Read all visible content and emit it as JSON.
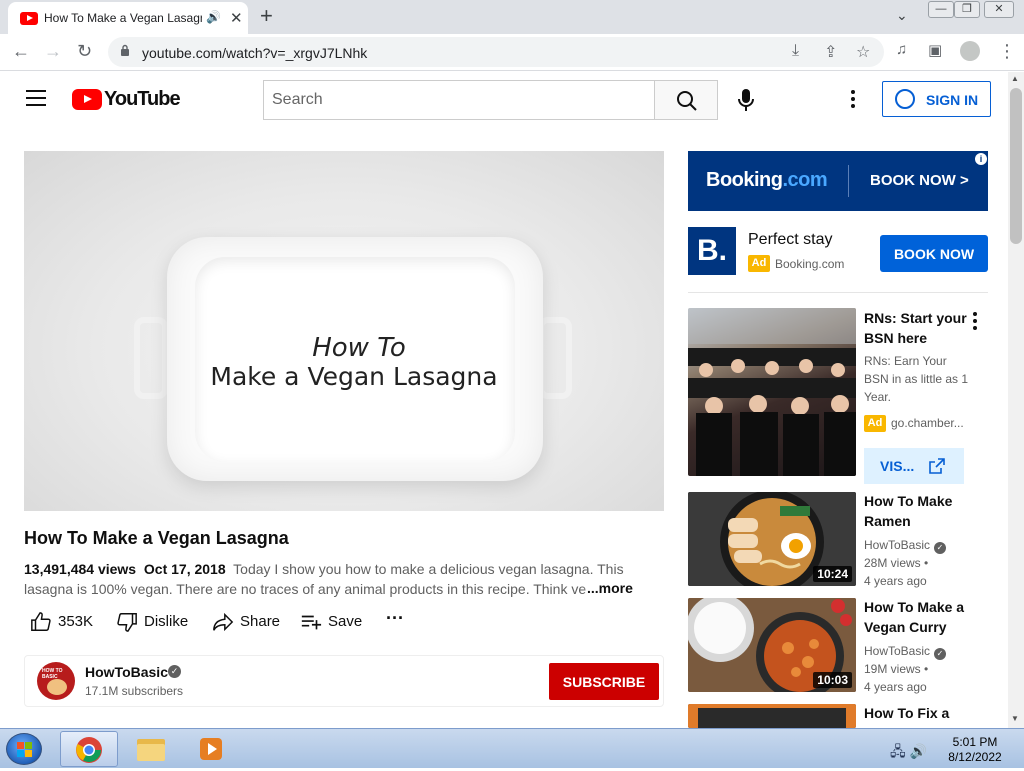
{
  "browser": {
    "tab_title": "How To Make a Vegan Lasagna - YouTube",
    "url": "youtube.com/watch?v=_xrgvJ7LNhk"
  },
  "youtube": {
    "logo_text": "YouTube",
    "search_placeholder": "Search",
    "sign_in": "SIGN IN"
  },
  "video": {
    "overlay_line1": "How To",
    "overlay_line2": "Make a Vegan Lasagna",
    "title": "How To Make a Vegan Lasagna",
    "views": "13,491,484 views",
    "date": "Oct 17, 2018",
    "description": "Today I show you how to make a delicious vegan lasagna. This lasagna is 100% vegan. There are no traces of any animal products in this recipe. Think ve",
    "more": "...more",
    "likes": "353K",
    "dislike": "Dislike",
    "share": "Share",
    "save": "Save"
  },
  "channel": {
    "avatar_text": "HOW TO BASIC",
    "name": "HowToBasic",
    "subscribers": "17.1M subscribers",
    "subscribe": "SUBSCRIBE"
  },
  "ad": {
    "banner_brand": "Booking",
    "banner_brand_tld": ".com",
    "banner_cta": "BOOK NOW >",
    "logo_letter": "B.",
    "headline": "Perfect stay",
    "badge": "Ad",
    "source": "Booking.com",
    "cta": "BOOK NOW"
  },
  "sponsored": {
    "title": "RNs: Start your BSN here",
    "desc": "RNs: Earn Your BSN in as little as 1 Year.",
    "badge": "Ad",
    "source": "go.chamber...",
    "cta": "VIS..."
  },
  "recommendations": [
    {
      "title": "How To Make Ramen",
      "channel": "HowToBasic",
      "views": "28M views •",
      "age": "4 years ago",
      "duration": "10:24"
    },
    {
      "title": "How To Make a Vegan Curry",
      "channel": "HowToBasic",
      "views": "19M views •",
      "age": "4 years ago",
      "duration": "10:03"
    },
    {
      "title": "How To Fix a"
    }
  ],
  "taskbar": {
    "time": "5:01 PM",
    "date": "8/12/2022"
  },
  "colors": {
    "yt_red": "#ff0000",
    "subscribe_red": "#cc0000",
    "link_blue": "#065fd4",
    "booking_navy": "#003580",
    "ad_yellow": "#f9b700"
  }
}
